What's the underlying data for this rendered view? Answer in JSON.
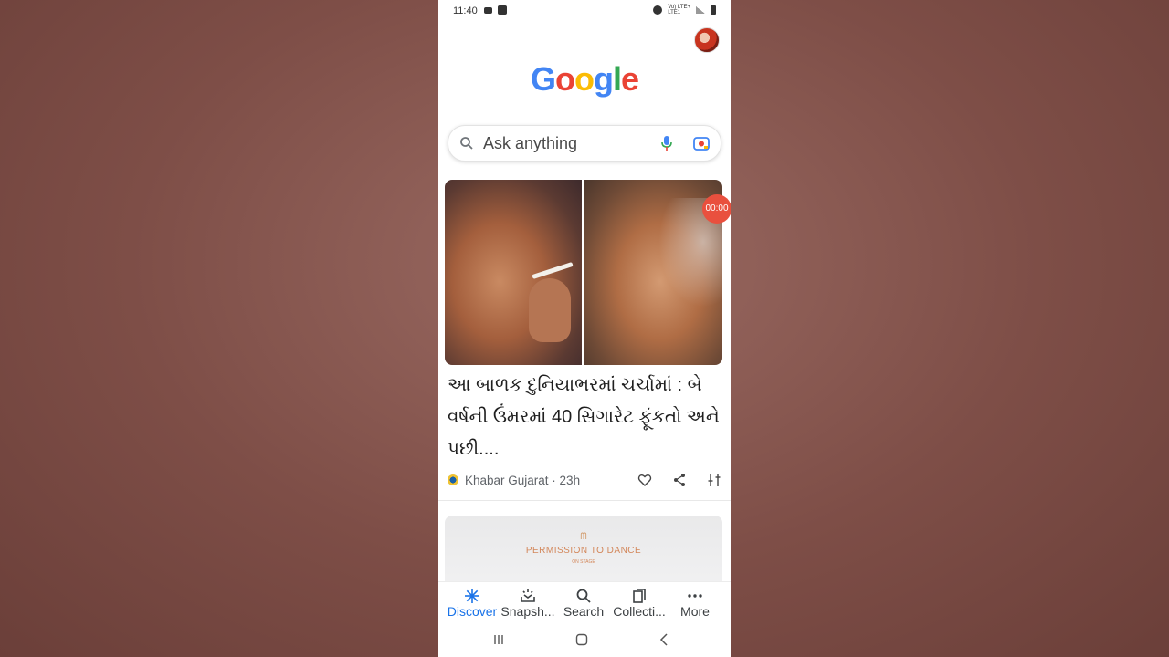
{
  "status_bar": {
    "time": "11:40",
    "network_label": "Vo) LTE+\nLTE1"
  },
  "logo": {
    "text": [
      "G",
      "o",
      "o",
      "g",
      "l",
      "e"
    ],
    "colors": [
      "#4285F4",
      "#EA4335",
      "#FBBC05",
      "#4285F4",
      "#34A853",
      "#EA4335"
    ]
  },
  "search": {
    "placeholder": "Ask anything"
  },
  "timer_badge": "00:00",
  "article": {
    "headline": "આ બાળક દુનિયાભરમાં ચર્ચામાં : બે વર્ષની ઉંમરમાં 40 સિગારેટ ફૂંકતો અને પછી....",
    "source": "Khabar Gujarat · 23h"
  },
  "next_card": {
    "logo": "ᗰ",
    "title": "PERMISSION TO DANCE",
    "subtitle": "ON STAGE"
  },
  "bottom_nav": {
    "items": [
      {
        "label": "Discover",
        "icon": "asterisk-icon",
        "active": true
      },
      {
        "label": "Snapsh...",
        "icon": "snapshot-icon",
        "active": false
      },
      {
        "label": "Search",
        "icon": "search-icon",
        "active": false
      },
      {
        "label": "Collecti...",
        "icon": "collections-icon",
        "active": false
      },
      {
        "label": "More",
        "icon": "more-dots-icon",
        "active": false
      }
    ]
  },
  "colors": {
    "accent": "#1a73e8",
    "badge": "#e9503e"
  }
}
